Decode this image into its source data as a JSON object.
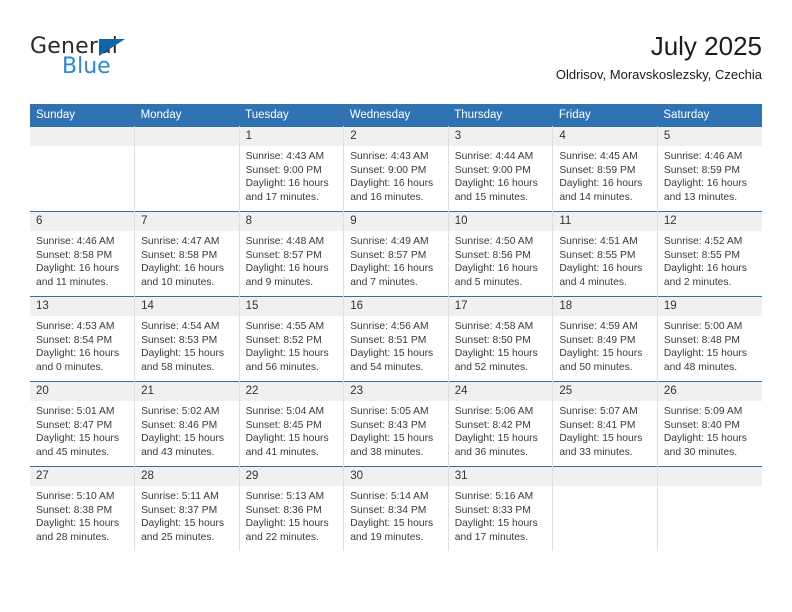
{
  "brand": {
    "name_part1": "General",
    "name_part2": "Blue",
    "triangle_icon": "brand-triangle-icon",
    "accent_dark": "#1464a5",
    "accent_light": "#2a88d4"
  },
  "header": {
    "title": "July 2025",
    "subtitle": "Oldrisov, Moravskoslezsky, Czechia"
  },
  "theme": {
    "header_blue": "#3173b2",
    "daynum_band": "#f0f0f0",
    "row_divider": "#2f6fae"
  },
  "weekday_headers": [
    "Sunday",
    "Monday",
    "Tuesday",
    "Wednesday",
    "Thursday",
    "Friday",
    "Saturday"
  ],
  "weeks": [
    [
      {
        "day": "",
        "sunrise": "",
        "sunset": "",
        "daylight_line1": "",
        "daylight_line2": ""
      },
      {
        "day": "",
        "sunrise": "",
        "sunset": "",
        "daylight_line1": "",
        "daylight_line2": ""
      },
      {
        "day": "1",
        "sunrise": "Sunrise: 4:43 AM",
        "sunset": "Sunset: 9:00 PM",
        "daylight_line1": "Daylight: 16 hours",
        "daylight_line2": "and 17 minutes."
      },
      {
        "day": "2",
        "sunrise": "Sunrise: 4:43 AM",
        "sunset": "Sunset: 9:00 PM",
        "daylight_line1": "Daylight: 16 hours",
        "daylight_line2": "and 16 minutes."
      },
      {
        "day": "3",
        "sunrise": "Sunrise: 4:44 AM",
        "sunset": "Sunset: 9:00 PM",
        "daylight_line1": "Daylight: 16 hours",
        "daylight_line2": "and 15 minutes."
      },
      {
        "day": "4",
        "sunrise": "Sunrise: 4:45 AM",
        "sunset": "Sunset: 8:59 PM",
        "daylight_line1": "Daylight: 16 hours",
        "daylight_line2": "and 14 minutes."
      },
      {
        "day": "5",
        "sunrise": "Sunrise: 4:46 AM",
        "sunset": "Sunset: 8:59 PM",
        "daylight_line1": "Daylight: 16 hours",
        "daylight_line2": "and 13 minutes."
      }
    ],
    [
      {
        "day": "6",
        "sunrise": "Sunrise: 4:46 AM",
        "sunset": "Sunset: 8:58 PM",
        "daylight_line1": "Daylight: 16 hours",
        "daylight_line2": "and 11 minutes."
      },
      {
        "day": "7",
        "sunrise": "Sunrise: 4:47 AM",
        "sunset": "Sunset: 8:58 PM",
        "daylight_line1": "Daylight: 16 hours",
        "daylight_line2": "and 10 minutes."
      },
      {
        "day": "8",
        "sunrise": "Sunrise: 4:48 AM",
        "sunset": "Sunset: 8:57 PM",
        "daylight_line1": "Daylight: 16 hours",
        "daylight_line2": "and 9 minutes."
      },
      {
        "day": "9",
        "sunrise": "Sunrise: 4:49 AM",
        "sunset": "Sunset: 8:57 PM",
        "daylight_line1": "Daylight: 16 hours",
        "daylight_line2": "and 7 minutes."
      },
      {
        "day": "10",
        "sunrise": "Sunrise: 4:50 AM",
        "sunset": "Sunset: 8:56 PM",
        "daylight_line1": "Daylight: 16 hours",
        "daylight_line2": "and 5 minutes."
      },
      {
        "day": "11",
        "sunrise": "Sunrise: 4:51 AM",
        "sunset": "Sunset: 8:55 PM",
        "daylight_line1": "Daylight: 16 hours",
        "daylight_line2": "and 4 minutes."
      },
      {
        "day": "12",
        "sunrise": "Sunrise: 4:52 AM",
        "sunset": "Sunset: 8:55 PM",
        "daylight_line1": "Daylight: 16 hours",
        "daylight_line2": "and 2 minutes."
      }
    ],
    [
      {
        "day": "13",
        "sunrise": "Sunrise: 4:53 AM",
        "sunset": "Sunset: 8:54 PM",
        "daylight_line1": "Daylight: 16 hours",
        "daylight_line2": "and 0 minutes."
      },
      {
        "day": "14",
        "sunrise": "Sunrise: 4:54 AM",
        "sunset": "Sunset: 8:53 PM",
        "daylight_line1": "Daylight: 15 hours",
        "daylight_line2": "and 58 minutes."
      },
      {
        "day": "15",
        "sunrise": "Sunrise: 4:55 AM",
        "sunset": "Sunset: 8:52 PM",
        "daylight_line1": "Daylight: 15 hours",
        "daylight_line2": "and 56 minutes."
      },
      {
        "day": "16",
        "sunrise": "Sunrise: 4:56 AM",
        "sunset": "Sunset: 8:51 PM",
        "daylight_line1": "Daylight: 15 hours",
        "daylight_line2": "and 54 minutes."
      },
      {
        "day": "17",
        "sunrise": "Sunrise: 4:58 AM",
        "sunset": "Sunset: 8:50 PM",
        "daylight_line1": "Daylight: 15 hours",
        "daylight_line2": "and 52 minutes."
      },
      {
        "day": "18",
        "sunrise": "Sunrise: 4:59 AM",
        "sunset": "Sunset: 8:49 PM",
        "daylight_line1": "Daylight: 15 hours",
        "daylight_line2": "and 50 minutes."
      },
      {
        "day": "19",
        "sunrise": "Sunrise: 5:00 AM",
        "sunset": "Sunset: 8:48 PM",
        "daylight_line1": "Daylight: 15 hours",
        "daylight_line2": "and 48 minutes."
      }
    ],
    [
      {
        "day": "20",
        "sunrise": "Sunrise: 5:01 AM",
        "sunset": "Sunset: 8:47 PM",
        "daylight_line1": "Daylight: 15 hours",
        "daylight_line2": "and 45 minutes."
      },
      {
        "day": "21",
        "sunrise": "Sunrise: 5:02 AM",
        "sunset": "Sunset: 8:46 PM",
        "daylight_line1": "Daylight: 15 hours",
        "daylight_line2": "and 43 minutes."
      },
      {
        "day": "22",
        "sunrise": "Sunrise: 5:04 AM",
        "sunset": "Sunset: 8:45 PM",
        "daylight_line1": "Daylight: 15 hours",
        "daylight_line2": "and 41 minutes."
      },
      {
        "day": "23",
        "sunrise": "Sunrise: 5:05 AM",
        "sunset": "Sunset: 8:43 PM",
        "daylight_line1": "Daylight: 15 hours",
        "daylight_line2": "and 38 minutes."
      },
      {
        "day": "24",
        "sunrise": "Sunrise: 5:06 AM",
        "sunset": "Sunset: 8:42 PM",
        "daylight_line1": "Daylight: 15 hours",
        "daylight_line2": "and 36 minutes."
      },
      {
        "day": "25",
        "sunrise": "Sunrise: 5:07 AM",
        "sunset": "Sunset: 8:41 PM",
        "daylight_line1": "Daylight: 15 hours",
        "daylight_line2": "and 33 minutes."
      },
      {
        "day": "26",
        "sunrise": "Sunrise: 5:09 AM",
        "sunset": "Sunset: 8:40 PM",
        "daylight_line1": "Daylight: 15 hours",
        "daylight_line2": "and 30 minutes."
      }
    ],
    [
      {
        "day": "27",
        "sunrise": "Sunrise: 5:10 AM",
        "sunset": "Sunset: 8:38 PM",
        "daylight_line1": "Daylight: 15 hours",
        "daylight_line2": "and 28 minutes."
      },
      {
        "day": "28",
        "sunrise": "Sunrise: 5:11 AM",
        "sunset": "Sunset: 8:37 PM",
        "daylight_line1": "Daylight: 15 hours",
        "daylight_line2": "and 25 minutes."
      },
      {
        "day": "29",
        "sunrise": "Sunrise: 5:13 AM",
        "sunset": "Sunset: 8:36 PM",
        "daylight_line1": "Daylight: 15 hours",
        "daylight_line2": "and 22 minutes."
      },
      {
        "day": "30",
        "sunrise": "Sunrise: 5:14 AM",
        "sunset": "Sunset: 8:34 PM",
        "daylight_line1": "Daylight: 15 hours",
        "daylight_line2": "and 19 minutes."
      },
      {
        "day": "31",
        "sunrise": "Sunrise: 5:16 AM",
        "sunset": "Sunset: 8:33 PM",
        "daylight_line1": "Daylight: 15 hours",
        "daylight_line2": "and 17 minutes."
      },
      {
        "day": "",
        "sunrise": "",
        "sunset": "",
        "daylight_line1": "",
        "daylight_line2": ""
      },
      {
        "day": "",
        "sunrise": "",
        "sunset": "",
        "daylight_line1": "",
        "daylight_line2": ""
      }
    ]
  ]
}
